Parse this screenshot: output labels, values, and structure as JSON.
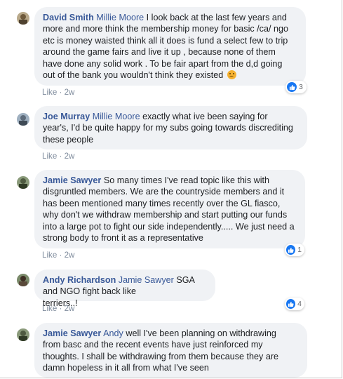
{
  "comments": [
    {
      "author": "David Smith",
      "mention": "Millie Moore",
      "lines": [
        " I look back at the last few years and",
        "more and more think the membership money for basic /ca/ ngo",
        "etc is money waisted think all it does is fund a select few to trip",
        "around the game fairs and live it up , because none of them",
        "have done any solid work . To be fair apart from the d,d going",
        "out of the bank you wouldn't think they existed"
      ],
      "emoji": "angry-face",
      "like_label": "Like",
      "time": "2w",
      "reactions": "3"
    },
    {
      "author": "Joe Murray",
      "mention": "Millie Moore",
      "lines": [
        " exactly what ive been saying for",
        "year's, I'd be quite happy for my subs going towards discrediting",
        "these people"
      ],
      "like_label": "Like",
      "time": "2w",
      "reactions": ""
    },
    {
      "author": "Jamie Sawyer",
      "mention": "",
      "lines": [
        " So many times I've read topic like this with",
        "disgruntled members. We are the countryside members and it",
        "has been mentioned many times recently over the GL fiasco,",
        "why don't we withdraw membership and start putting our funds",
        "into a large pot to fight our side independently..... We just need a",
        "strong body to front it as a representative"
      ],
      "like_label": "Like",
      "time": "2w",
      "reactions": "1"
    },
    {
      "author": "Andy Richardson",
      "mention": "Jamie Sawyer",
      "lines": [
        " SGA and NGO fight back like",
        "terriers..!"
      ],
      "like_label": "Like",
      "time": "2w",
      "reactions": "4"
    },
    {
      "author": "Jamie Sawyer",
      "mention": "Andy",
      "lines": [
        " well I've been planning on withdrawing",
        "from basc and the recent events have just reinforced my",
        "thoughts. I shall be withdrawing from them because they are",
        "damn hopeless in it all from what I've seen"
      ],
      "like_label": "",
      "time": "",
      "reactions": ""
    }
  ],
  "separator": " · "
}
